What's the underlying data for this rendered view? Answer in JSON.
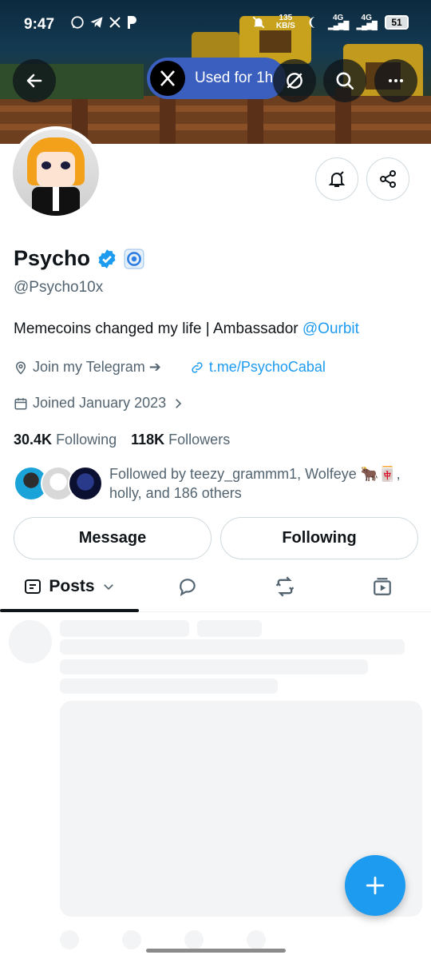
{
  "status_bar": {
    "time": "9:47",
    "app_icons": [
      "whatsapp-icon",
      "telegram-icon",
      "x-icon",
      "p-icon"
    ],
    "net_speed": "135 KB/S",
    "signal_1": "4G",
    "signal_2": "4G",
    "battery": "51"
  },
  "header": {
    "usage_pill": "Used for 1h",
    "buttons": [
      "back-arrow-icon",
      "grok-icon",
      "search-icon",
      "more-icon"
    ]
  },
  "profile": {
    "name": "Psycho",
    "handle": "@Psycho10x",
    "bio_text": "Memecoins changed my life | Ambassador ",
    "bio_mention": "@Ourbit",
    "location": "Join my Telegram ➔",
    "website": "t.me/PsychoCabal",
    "joined": "Joined January 2023",
    "following_count": "30.4K",
    "following_label": "Following",
    "followers_count": "118K",
    "followers_label": "Followers",
    "followed_by": "Followed by teezy_grammm1, Wolfeye 🐂🀄,",
    "followed_by_line2": "holly, and 186 others"
  },
  "actions": {
    "message": "Message",
    "following": "Following"
  },
  "tabs": {
    "posts": "Posts"
  },
  "colors": {
    "accent": "#1d9bf0",
    "verified": "#1d9bf0",
    "text_secondary": "#536471",
    "pill": "#3a5fbf"
  }
}
